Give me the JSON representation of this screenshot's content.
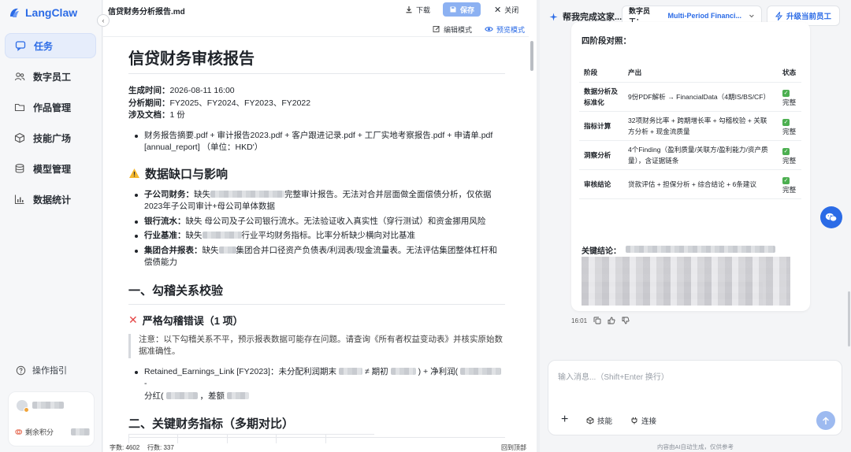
{
  "app": {
    "name": "LangClaw"
  },
  "sidebar": {
    "items": [
      {
        "label": "任务",
        "icon": "chat-bubble-icon",
        "active": true
      },
      {
        "label": "数字员工",
        "icon": "users-icon",
        "active": false
      },
      {
        "label": "作品管理",
        "icon": "folder-icon",
        "active": false
      },
      {
        "label": "技能广场",
        "icon": "cube-icon",
        "active": false
      },
      {
        "label": "模型管理",
        "icon": "database-icon",
        "active": false
      },
      {
        "label": "数据统计",
        "icon": "bar-chart-icon",
        "active": false
      }
    ],
    "guide": "操作指引",
    "credits_label": "剩余积分"
  },
  "editor": {
    "file_name": "信贷财务分析报告.md",
    "download": "下载",
    "save": "保存",
    "close": "关闭",
    "edit_mode": "编辑模式",
    "preview_mode": "预览模式",
    "doc": {
      "title": "信贷财务审核报告",
      "meta": [
        {
          "k": "生成时间：",
          "v": "2026-08-11 16:00"
        },
        {
          "k": "分析期间：",
          "v": "FY2025、FY2024、FY2023、FY2022"
        },
        {
          "k": "涉及文档：",
          "v": "1 份"
        }
      ],
      "files_bullet": "财务报告摘要.pdf + 审计报告2023.pdf + 客户跟进记录.pdf + 工厂实地考察报告.pdf + 申请单.pdf [annual_report] （单位：HKD'）",
      "gap_heading": "数据缺口与影响",
      "gaps": [
        {
          "k": "子公司财务：",
          "a": "缺失",
          "b": "完整审计报告。无法对合并层面做全面偿债分析，仅依据2023年子公司审计+母公司单体数据"
        },
        {
          "k": "银行流水：",
          "a": "缺失 母公司及子公司银行流水。无法验证收入真实性（穿行测试）和资金挪用风险",
          "b": ""
        },
        {
          "k": "行业基准：",
          "a": "缺失",
          "b": "行业平均财务指标。比率分析缺少横向对比基准"
        },
        {
          "k": "集团合并报表：",
          "a": "缺失",
          "b": "集团合并口径资产负债表/利润表/现金流量表。无法评估集团整体杠杆和偿债能力"
        }
      ],
      "sec1": "一、勾稽关系校验",
      "sec1_sub": "严格勾稽错误（1 项）",
      "note": "注意：以下勾稽关系不平，预示报表数据可能存在问题。请查询《所有者权益变动表》并核实原始数据准确性。",
      "retained_a": "Retained_Earnings_Link [FY2023]：未分配利润期末",
      "retained_b": "≠ 期初",
      "retained_c": ") + 净利润(",
      "retained_d": "-",
      "retained_e": "分红(",
      "retained_f": "，差额",
      "sec2": "二、关键财务指标（多期对比）"
    },
    "status_chars": "字数: 4602",
    "status_lines": "行数: 337",
    "back_top": "回到顶部"
  },
  "chat": {
    "title": "帮我完成这家...",
    "employee_label": "数字员工：",
    "employee_value": "Multi-Period Financi...",
    "upgrade": "升级当前员工",
    "message": {
      "heading": "四阶段对照：",
      "headers": [
        "阶段",
        "产出",
        "状态"
      ],
      "rows": [
        {
          "stage": "数据分析及标准化",
          "output": "9份PDF解析 → FinancialData（4期IS/BS/CF）",
          "status": "完整"
        },
        {
          "stage": "指标计算",
          "output": "32项财务比率 + 跨期增长率 + 勾稽校验 + 关联方分析 + 现金流质量",
          "status": "完整"
        },
        {
          "stage": "洞察分析",
          "output": "4个Finding（盈利质量/关联方/盈利能力/资产质量），含证据链条",
          "status": "完整"
        },
        {
          "stage": "审核结论",
          "output": "贷款评估 + 担保分析 + 综合结论 + 6条建议",
          "status": "完整"
        }
      ],
      "key_label": "关键结论：",
      "time": "16:01"
    },
    "input_placeholder": "输入消息...（Shift+Enter 换行）",
    "skills": "技能",
    "connect": "连接",
    "footnote": "内容由AI自动生成，仅供参考"
  },
  "colors": {
    "accent": "#2b6be6",
    "save_bg": "#8cb1f2",
    "check": "#4caf50"
  }
}
